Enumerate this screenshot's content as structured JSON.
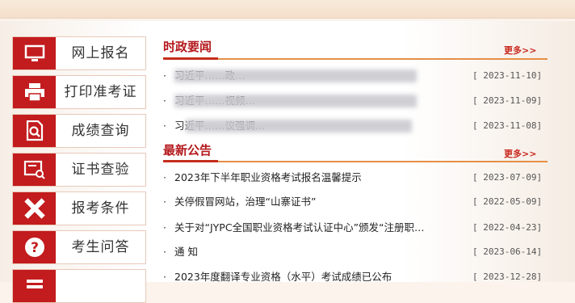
{
  "sidebar": {
    "items": [
      {
        "label": "网上报名",
        "icon": "monitor-icon"
      },
      {
        "label": "打印准考证",
        "icon": "printer-icon"
      },
      {
        "label": "成绩查询",
        "icon": "document-search-icon"
      },
      {
        "label": "证书查验",
        "icon": "certificate-search-icon"
      },
      {
        "label": "报考条件",
        "icon": "ruler-pencil-icon"
      },
      {
        "label": "考生问答",
        "icon": "question-icon"
      }
    ]
  },
  "news": {
    "title": "时政要闻",
    "more": "更多>>",
    "items": [
      {
        "text": "习近平……政…",
        "date": "[ 2023-11-10]"
      },
      {
        "text": "习近平……视频…",
        "date": "[ 2023-11-09]"
      },
      {
        "text": "习近平……议强调…",
        "date": "[ 2023-11-08]"
      }
    ]
  },
  "notices": {
    "title": "最新公告",
    "more": "更多>>",
    "items": [
      {
        "text": "2023年下半年职业资格考试报名温馨提示",
        "date": "[ 2023-07-09]"
      },
      {
        "text": "关停假冒网站，治理“山寨证书”",
        "date": "[ 2022-05-09]"
      },
      {
        "text": "关于对“JYPC全国职业资格考试认证中心”颁发“注册职…",
        "date": "[ 2022-04-23]"
      },
      {
        "text": "通 知",
        "date": "[ 2023-06-14]"
      },
      {
        "text": "2023年度翻译专业资格（水平）考试成绩已公布",
        "date": "[ 2023-12-28]"
      }
    ]
  },
  "colors": {
    "accent": "#c21c1e",
    "line": "#e58f48"
  }
}
